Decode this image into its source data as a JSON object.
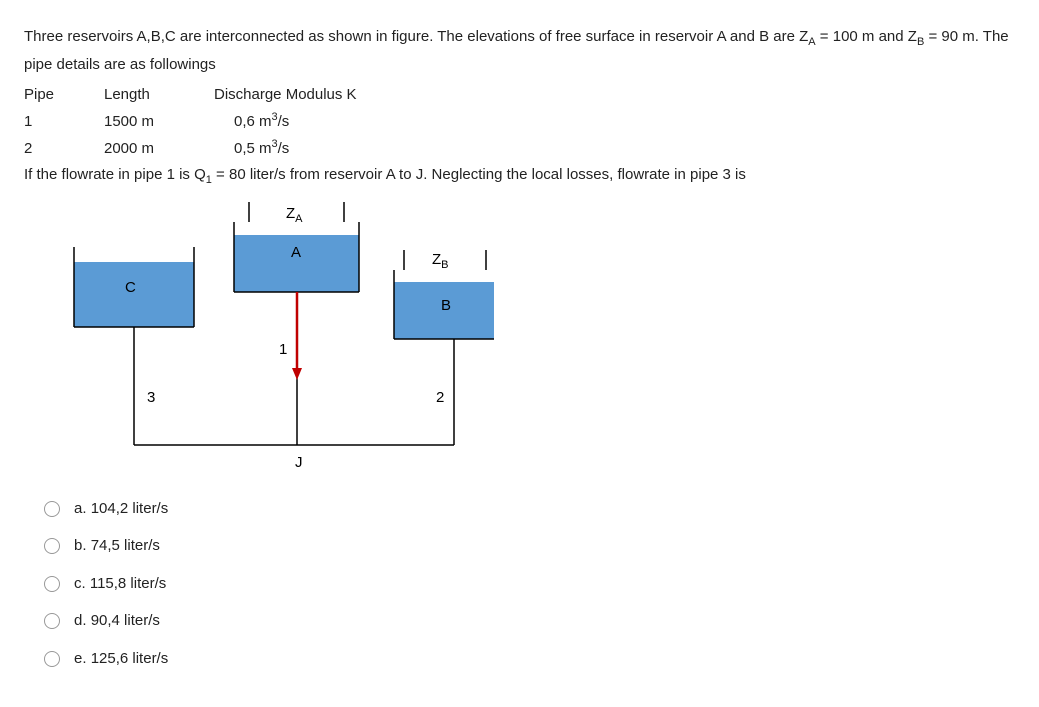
{
  "question": {
    "para1": "Three reservoirs A,B,C are interconnected as shown in figure. The elevations of free surface in reservoir A and B are Z",
    "para1_sub1": "A",
    "para1_mid": " = 100 m and Z",
    "para1_sub2": "B",
    "para1_end": " = 90 m. The  pipe details are as followings",
    "table": {
      "header": {
        "c1": "Pipe",
        "c2": "Length",
        "c3": "Discharge Modulus K"
      },
      "rows": [
        {
          "c1": "1",
          "c2": "1500 m",
          "c3_pre": "0,6 m",
          "c3_sup": "3",
          "c3_post": "/s"
        },
        {
          "c1": "2",
          "c2": "2000 m",
          "c3_pre": "0,5 m",
          "c3_sup": "3",
          "c3_post": "/s"
        }
      ]
    },
    "para2_pre": "If the flowrate in pipe 1 is  Q",
    "para2_sub": "1",
    "para2_post": " = 80 liter/s from reservoir A to J. Neglecting the local losses, flowrate in pipe 3 is"
  },
  "figure": {
    "za": "Z",
    "za_sub": "A",
    "zb": "Z",
    "zb_sub": "B",
    "labelA": "A",
    "labelB": "B",
    "labelC": "C",
    "label1": "1",
    "label2": "2",
    "label3": "3",
    "labelJ": "J"
  },
  "options": [
    {
      "letter": "a.",
      "text": "104,2 liter/s"
    },
    {
      "letter": "b.",
      "text": "74,5 liter/s"
    },
    {
      "letter": "c.",
      "text": "115,8 liter/s"
    },
    {
      "letter": "d.",
      "text": "90,4 liter/s"
    },
    {
      "letter": "e.",
      "text": "125,6 liter/s"
    }
  ]
}
